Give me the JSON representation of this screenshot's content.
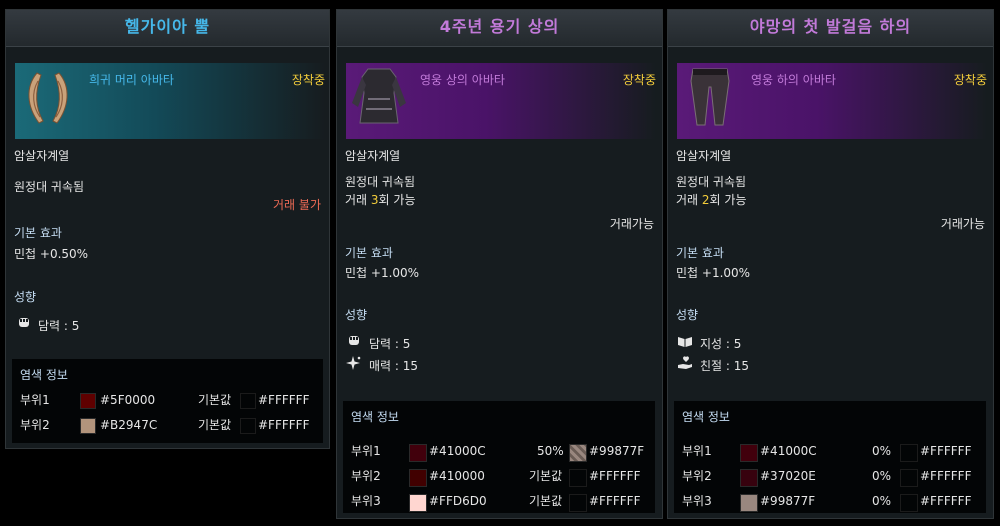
{
  "colors": {
    "header_blue": "#46b8ea",
    "header_purple": "#c27ad9",
    "equipped": "#f3cd3b",
    "untradable": "#ee6a55",
    "highlight": "#f3cd3b",
    "section": "#c4dcf2"
  },
  "cards": [
    {
      "title": "헬가이아 뿔",
      "item_type": "희귀 머리 아바타",
      "equipped": "장착중",
      "job": "암살자계열",
      "bound": "원정대 귀속됨",
      "trade": "거래 불가",
      "basic_header": "기본 효과",
      "basic_value": "민첩 +0.50%",
      "tendency_header": "성향",
      "tendencies": [
        {
          "icon": "fist-icon",
          "label": "담력 : 5"
        }
      ],
      "dye_header": "염색 정보",
      "dye_rows": [
        {
          "part": "부위1",
          "color": "#5F0000",
          "default_label": "기본값",
          "default_color": "#FFFFFF"
        },
        {
          "part": "부위2",
          "color": "#B2947C",
          "default_label": "기본값",
          "default_color": "#FFFFFF"
        }
      ]
    },
    {
      "title": "4주년 용기 상의",
      "item_type": "영웅 상의 아바타",
      "equipped": "장착중",
      "job": "암살자계열",
      "bound": "원정대 귀속됨",
      "trade_prefix": "거래 ",
      "trade_count": "3",
      "trade_suffix": "회 가능",
      "tradable": "거래가능",
      "basic_header": "기본 효과",
      "basic_value": "민첩 +1.00%",
      "tendency_header": "성향",
      "tendencies": [
        {
          "icon": "fist-icon",
          "label": "담력 : 5"
        },
        {
          "icon": "sparkle-icon",
          "label": "매력 : 15"
        }
      ],
      "dye_header": "염색 정보",
      "dye_rows": [
        {
          "part": "부위1",
          "color": "#41000C",
          "default_label": "50%",
          "default_color": "#99877F"
        },
        {
          "part": "부위2",
          "color": "#410000",
          "default_label": "기본값",
          "default_color": "#FFFFFF"
        },
        {
          "part": "부위3",
          "color": "#FFD6D0",
          "default_label": "기본값",
          "default_color": "#FFFFFF"
        }
      ]
    },
    {
      "title": "야망의 첫 발걸음 하의",
      "item_type": "영웅 하의 아바타",
      "equipped": "장착중",
      "job": "암살자계열",
      "bound": "원정대 귀속됨",
      "trade_prefix": "거래 ",
      "trade_count": "2",
      "trade_suffix": "회 가능",
      "tradable": "거래가능",
      "basic_header": "기본 효과",
      "basic_value": "민첩 +1.00%",
      "tendency_header": "성향",
      "tendencies": [
        {
          "icon": "book-icon",
          "label": "지성 : 5"
        },
        {
          "icon": "heart-hand-icon",
          "label": "친절 : 15"
        }
      ],
      "dye_header": "염색 정보",
      "dye_rows": [
        {
          "part": "부위1",
          "color": "#41000C",
          "default_label": "0%",
          "default_color": "#FFFFFF"
        },
        {
          "part": "부위2",
          "color": "#37020E",
          "default_label": "0%",
          "default_color": "#FFFFFF"
        },
        {
          "part": "부위3",
          "color": "#99877F",
          "default_label": "0%",
          "default_color": "#FFFFFF"
        }
      ]
    }
  ]
}
